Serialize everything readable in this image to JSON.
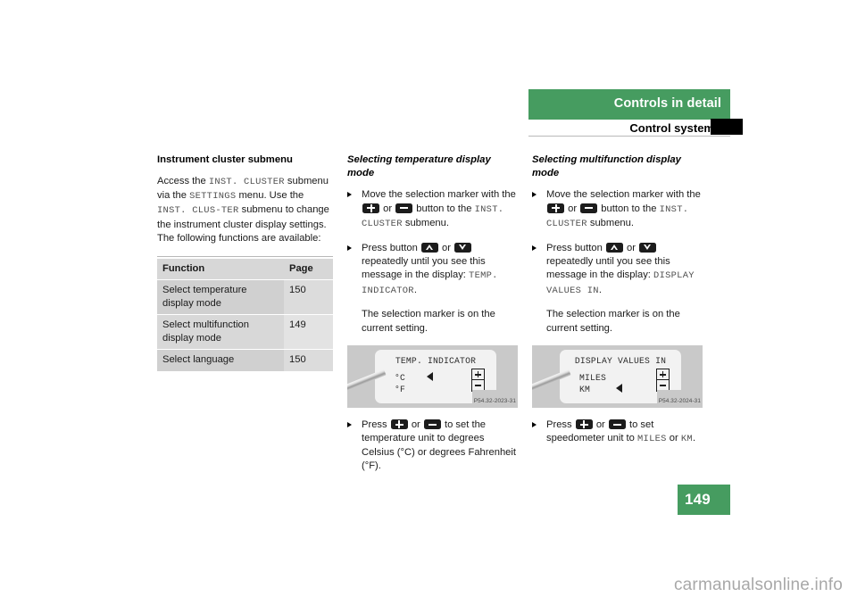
{
  "header": {
    "title": "Controls in detail",
    "subtitle": "Control system"
  },
  "page_number": "149",
  "watermark": "carmanualsonline.info",
  "left_column": {
    "heading": "Instrument cluster submenu",
    "para_1_a": "Access the ",
    "para_1_mono_1": "INST. CLUSTER",
    "para_1_b": " submenu via the ",
    "para_1_mono_2": "SETTINGS",
    "para_1_c": " menu. Use the ",
    "para_1_mono_3": "INST. CLUS-TER",
    "para_1_d": " submenu to change the instrument cluster display settings. The following functions are available:",
    "table": {
      "columns": [
        "Function",
        "Page"
      ],
      "rows": [
        {
          "function": "Select temperature display mode",
          "page": "150"
        },
        {
          "function": "Select multifunction display mode",
          "page": "149"
        },
        {
          "function": "Select language",
          "page": "150"
        }
      ]
    }
  },
  "mid_column": {
    "heading": "Selecting temperature display mode",
    "bullet_1": {
      "a": "Move the selection marker with the ",
      "btn_1": "plus-button",
      "or": " or ",
      "btn_2": "minus-button",
      "b": " button to the ",
      "mono": "INST. CLUSTER",
      "c": " submenu."
    },
    "bullet_2": {
      "a": "Press button ",
      "btn_1": "up-button",
      "or": " or ",
      "btn_2": "down-button",
      "b": " repeatedly until you see this message in the display: ",
      "mono": "TEMP. INDICATOR",
      "c": "."
    },
    "note": "The selection marker is on the current setting.",
    "illustration": {
      "lcd_title": "TEMP. INDICATOR",
      "lcd_option_1": "°C",
      "lcd_option_2": "°F",
      "marker_on": "option_1",
      "code": "P54.32-2023-31"
    },
    "bullet_3": {
      "a": "Press ",
      "btn_1": "plus-button",
      "or": " or ",
      "btn_2": "minus-button",
      "b": " to set the temperature unit to degrees Celsius (°C) or degrees Fahrenheit (°F)."
    }
  },
  "right_column": {
    "heading": "Selecting multifunction display mode",
    "bullet_1": {
      "a": "Move the selection marker with the ",
      "btn_1": "plus-button",
      "or": " or ",
      "btn_2": "minus-button",
      "b": " button to the ",
      "mono": "INST. CLUSTER",
      "c": " submenu."
    },
    "bullet_2": {
      "a": "Press button ",
      "btn_1": "up-button",
      "or": " or ",
      "btn_2": "down-button",
      "b": " repeatedly until you see this message in the display: ",
      "mono": "DISPLAY VALUES IN",
      "c": "."
    },
    "note": "The selection marker is on the current setting.",
    "illustration": {
      "lcd_title": "DISPLAY VALUES IN",
      "lcd_option_1": "MILES",
      "lcd_option_2": "KM",
      "marker_on": "option_2",
      "code": "P54.32-2024-31"
    },
    "bullet_3": {
      "a": "Press ",
      "btn_1": "plus-button",
      "or": " or ",
      "btn_2": "minus-button",
      "b": " to set speedometer unit to ",
      "mono_1": "MILES",
      "c": " or ",
      "mono_2": "KM",
      "d": "."
    }
  },
  "colors": {
    "brand_green": "#469c60",
    "header_text": "#ffffff",
    "table_header_bg": "#d7d7d7",
    "illustration_bg": "#c9c9c9"
  }
}
